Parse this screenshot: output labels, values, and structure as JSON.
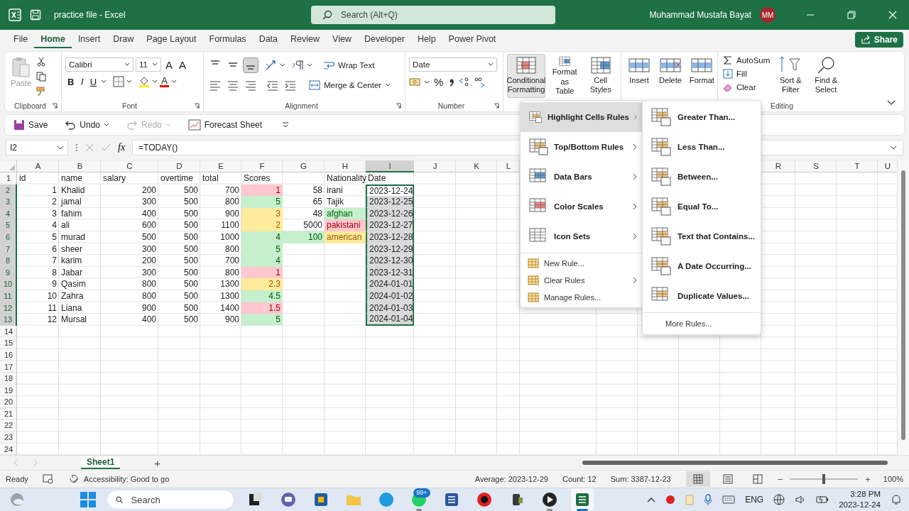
{
  "title_bar": {
    "title": "practice file - Excel",
    "search_placeholder": "Search (Alt+Q)",
    "user_name": "Muhammad Mustafa Bayat",
    "user_initials": "MM"
  },
  "menu_tabs": [
    {
      "label": "File",
      "selected": false
    },
    {
      "label": "Home",
      "selected": true
    },
    {
      "label": "Insert",
      "selected": false
    },
    {
      "label": "Draw",
      "selected": false
    },
    {
      "label": "Page Layout",
      "selected": false
    },
    {
      "label": "Formulas",
      "selected": false
    },
    {
      "label": "Data",
      "selected": false
    },
    {
      "label": "Review",
      "selected": false
    },
    {
      "label": "View",
      "selected": false
    },
    {
      "label": "Developer",
      "selected": false
    },
    {
      "label": "Help",
      "selected": false
    },
    {
      "label": "Power Pivot",
      "selected": false
    }
  ],
  "share_button": "Share",
  "ribbon": {
    "clipboard": {
      "paste": {
        "label": "Paste",
        "disabled": true
      },
      "label": "Clipboard"
    },
    "font": {
      "font_name": "Calibri",
      "font_size": "11",
      "grow": "A",
      "shrink": "A",
      "bold": "B",
      "italic": "I",
      "underline": "U",
      "font_color": "A",
      "label": "Font"
    },
    "alignment": {
      "vertical_align_buttons": [
        {
          "selected": false
        },
        {
          "selected": false
        },
        {
          "selected": true
        }
      ],
      "wrap_text": "Wrap Text",
      "merge": "Merge & Center",
      "label": "Alignment"
    },
    "number": {
      "format": "Date",
      "percent": "%",
      "label": "Number"
    },
    "styles": [
      {
        "label": "Conditional Formatting",
        "selected": true
      },
      {
        "label": "Format as Table",
        "selected": false
      },
      {
        "label": "Cell Styles",
        "selected": false
      }
    ],
    "cells": [
      "Insert",
      "Delete",
      "Format"
    ],
    "editing": {
      "autosum": "AutoSum",
      "fill": "Fill",
      "clear": "Clear",
      "sort": "Sort & Filter",
      "find": "Find & Select",
      "label": "Editing"
    }
  },
  "quick_access": [
    {
      "label": "Save",
      "disabled": false
    },
    {
      "label": "Undo",
      "disabled": false
    },
    {
      "label": "Redo",
      "disabled": true
    },
    {
      "label": "Forecast Sheet",
      "disabled": false
    }
  ],
  "formula_bar": {
    "name_box": "I2",
    "fx": "fx",
    "formula": "=TODAY()"
  },
  "sheet": {
    "columns": [
      {
        "letter": "A",
        "selected": false
      },
      {
        "letter": "B",
        "selected": false
      },
      {
        "letter": "C",
        "selected": false
      },
      {
        "letter": "D",
        "selected": false
      },
      {
        "letter": "E",
        "selected": false
      },
      {
        "letter": "F",
        "selected": false
      },
      {
        "letter": "G",
        "selected": false
      },
      {
        "letter": "H",
        "selected": false
      },
      {
        "letter": "I",
        "selected": true
      },
      {
        "letter": "J",
        "selected": false
      },
      {
        "letter": "K",
        "selected": false
      },
      {
        "letter": "L",
        "selected": false
      },
      {
        "letter": "R",
        "selected": false
      },
      {
        "letter": "S",
        "selected": false
      },
      {
        "letter": "T",
        "selected": false
      },
      {
        "letter": "U",
        "selected": false
      }
    ],
    "rows": [
      {
        "number": "1",
        "cells": [
          {
            "text": "id"
          },
          {
            "text": "name"
          },
          {
            "text": "salary"
          },
          {
            "text": "overtime"
          },
          {
            "text": "total"
          },
          {
            "text": "Scores"
          },
          null,
          {
            "text": "Nationality"
          }
        ],
        "date": {
          "text": "Date",
          "selected": false,
          "active": false
        }
      },
      {
        "number": "2",
        "cells": [
          {
            "text": "1"
          },
          {
            "text": "Khalid"
          },
          {
            "text": "200"
          },
          {
            "text": "500"
          },
          {
            "text": "700"
          },
          {
            "text": "1",
            "color": "#ffc7ce"
          },
          {
            "text": "58"
          },
          {
            "text": "irani"
          }
        ],
        "date": {
          "text": "2023-12-24",
          "selected": true,
          "active": true
        }
      },
      {
        "number": "3",
        "cells": [
          {
            "text": "2"
          },
          {
            "text": "jamal"
          },
          {
            "text": "300"
          },
          {
            "text": "500"
          },
          {
            "text": "800"
          },
          {
            "text": "5",
            "color": "#c6efce"
          },
          {
            "text": "65"
          },
          {
            "text": "Tajik"
          }
        ],
        "date": {
          "text": "2023-12-25",
          "selected": true,
          "active": false
        }
      },
      {
        "number": "4",
        "cells": [
          {
            "text": "3"
          },
          {
            "text": "fahim"
          },
          {
            "text": "400"
          },
          {
            "text": "500"
          },
          {
            "text": "900"
          },
          {
            "text": "3",
            "color": "#ffeb9c"
          },
          {
            "text": "48"
          },
          {
            "text": "afghan",
            "color": "#c6efce"
          }
        ],
        "date": {
          "text": "2023-12-26",
          "selected": true,
          "active": false
        }
      },
      {
        "number": "5",
        "cells": [
          {
            "text": "4"
          },
          {
            "text": "ali"
          },
          {
            "text": "600"
          },
          {
            "text": "500"
          },
          {
            "text": "1100"
          },
          {
            "text": "2",
            "color": "#ffeb9c"
          },
          {
            "text": "5000"
          },
          {
            "text": "pakistani",
            "color": "#ffc7ce"
          }
        ],
        "date": {
          "text": "2023-12-27",
          "selected": true,
          "active": false
        }
      },
      {
        "number": "6",
        "cells": [
          {
            "text": "5"
          },
          {
            "text": "murad"
          },
          {
            "text": "500"
          },
          {
            "text": "500"
          },
          {
            "text": "1000"
          },
          {
            "text": "4",
            "color": "#c6efce"
          },
          {
            "text": "100",
            "color": "#c6efce"
          },
          {
            "text": "american",
            "color": "#ffeb9c"
          }
        ],
        "date": {
          "text": "2023-12-28",
          "selected": true,
          "active": false
        }
      },
      {
        "number": "7",
        "cells": [
          {
            "text": "6"
          },
          {
            "text": "sheer"
          },
          {
            "text": "300"
          },
          {
            "text": "500"
          },
          {
            "text": "800"
          },
          {
            "text": "5",
            "color": "#c6efce"
          },
          null,
          null
        ],
        "date": {
          "text": "2023-12-29",
          "selected": true,
          "active": false
        }
      },
      {
        "number": "8",
        "cells": [
          {
            "text": "7"
          },
          {
            "text": "karim"
          },
          {
            "text": "200"
          },
          {
            "text": "500"
          },
          {
            "text": "700"
          },
          {
            "text": "4",
            "color": "#c6efce"
          },
          null,
          null
        ],
        "date": {
          "text": "2023-12-30",
          "selected": true,
          "active": false
        }
      },
      {
        "number": "9",
        "cells": [
          {
            "text": "8"
          },
          {
            "text": "Jabar"
          },
          {
            "text": "300"
          },
          {
            "text": "500"
          },
          {
            "text": "800"
          },
          {
            "text": "1",
            "color": "#ffc7ce"
          },
          null,
          null
        ],
        "date": {
          "text": "2023-12-31",
          "selected": true,
          "active": false
        }
      },
      {
        "number": "10",
        "cells": [
          {
            "text": "9"
          },
          {
            "text": "Qasim"
          },
          {
            "text": "800"
          },
          {
            "text": "500"
          },
          {
            "text": "1300"
          },
          {
            "text": "2.3",
            "color": "#ffeb9c"
          },
          null,
          null
        ],
        "date": {
          "text": "2024-01-01",
          "selected": true,
          "active": false
        }
      },
      {
        "number": "11",
        "cells": [
          {
            "text": "10"
          },
          {
            "text": "Zahra"
          },
          {
            "text": "800"
          },
          {
            "text": "500"
          },
          {
            "text": "1300"
          },
          {
            "text": "4.5",
            "color": "#c6efce"
          },
          null,
          null
        ],
        "date": {
          "text": "2024-01-02",
          "selected": true,
          "active": false
        }
      },
      {
        "number": "12",
        "cells": [
          {
            "text": "11"
          },
          {
            "text": "Liana"
          },
          {
            "text": "900"
          },
          {
            "text": "500"
          },
          {
            "text": "1400"
          },
          {
            "text": "1.5",
            "color": "#ffc7ce"
          },
          null,
          null
        ],
        "date": {
          "text": "2024-01-03",
          "selected": true,
          "active": false
        }
      },
      {
        "number": "13",
        "cells": [
          {
            "text": "12"
          },
          {
            "text": "Mursal"
          },
          {
            "text": "400"
          },
          {
            "text": "500"
          },
          {
            "text": "900"
          },
          {
            "text": "5",
            "color": "#c6efce"
          },
          null,
          null
        ],
        "date": {
          "text": "2024-01-04",
          "selected": true,
          "active": false
        }
      }
    ],
    "empty_rows": [
      "14",
      "15",
      "16",
      "17",
      "18",
      "19",
      "20",
      "21",
      "22",
      "23",
      "24"
    ]
  },
  "conditional_formatting_menu": [
    {
      "label": "Highlight Cells Rules",
      "kind": "large",
      "submenu": true,
      "selected": true
    },
    {
      "label": "Top/Bottom Rules",
      "kind": "large",
      "submenu": true,
      "selected": false
    },
    {
      "label": "Data Bars",
      "kind": "large",
      "submenu": true,
      "selected": false
    },
    {
      "label": "Color Scales",
      "kind": "large",
      "submenu": true,
      "selected": false
    },
    {
      "label": "Icon Sets",
      "kind": "large",
      "submenu": true,
      "selected": false
    },
    {
      "label": "New Rule...",
      "kind": "small",
      "submenu": false,
      "selected": false
    },
    {
      "label": "Clear Rules",
      "kind": "small",
      "submenu": true,
      "selected": false
    },
    {
      "label": "Manage Rules...",
      "kind": "small",
      "submenu": false,
      "selected": false
    }
  ],
  "highlight_cells_submenu": [
    {
      "label": "Greater Than...",
      "kind": "large"
    },
    {
      "label": "Less Than...",
      "kind": "large"
    },
    {
      "label": "Between...",
      "kind": "large"
    },
    {
      "label": "Equal To...",
      "kind": "large"
    },
    {
      "label": "Text that Contains...",
      "kind": "large"
    },
    {
      "label": "A Date Occurring...",
      "kind": "large"
    },
    {
      "label": "Duplicate Values...",
      "kind": "large"
    },
    {
      "label": "More Rules...",
      "kind": "small"
    }
  ],
  "sheet_tabs": {
    "tabs": [
      {
        "label": "Sheet1",
        "selected": true
      }
    ],
    "add": "+"
  },
  "status_bar": {
    "ready": "Ready",
    "accessibility": "Accessibility: Good to go",
    "average": "Average: 2023-12-29",
    "count": "Count: 12",
    "sum": "Sum: 3387-12-23",
    "views": [
      {
        "selected": true
      },
      {
        "selected": false
      },
      {
        "selected": false
      }
    ],
    "zoom_minus": "−",
    "zoom_plus": "+",
    "zoom": {
      "level": 0.5
    },
    "zoom_text": "100%"
  },
  "taskbar": {
    "search_placeholder": "Search",
    "language": "ENG",
    "time": "3:28 PM",
    "date": "2023-12-24",
    "apps": [
      {
        "kind": "taskview",
        "running": false,
        "selected": false
      },
      {
        "kind": "chat",
        "running": false,
        "selected": false
      },
      {
        "kind": "store",
        "running": false,
        "selected": false
      },
      {
        "kind": "folder",
        "running": false,
        "selected": false
      },
      {
        "kind": "browser",
        "running": false,
        "selected": false
      },
      {
        "kind": "whatsapp",
        "running": true,
        "selected": false,
        "badge": "99+"
      },
      {
        "kind": "word",
        "running": false,
        "selected": false
      },
      {
        "kind": "record",
        "running": false,
        "selected": false
      },
      {
        "kind": "camera",
        "running": false,
        "selected": false
      },
      {
        "kind": "player",
        "running": true,
        "selected": false
      },
      {
        "kind": "excel",
        "running": true,
        "selected": true
      }
    ]
  }
}
